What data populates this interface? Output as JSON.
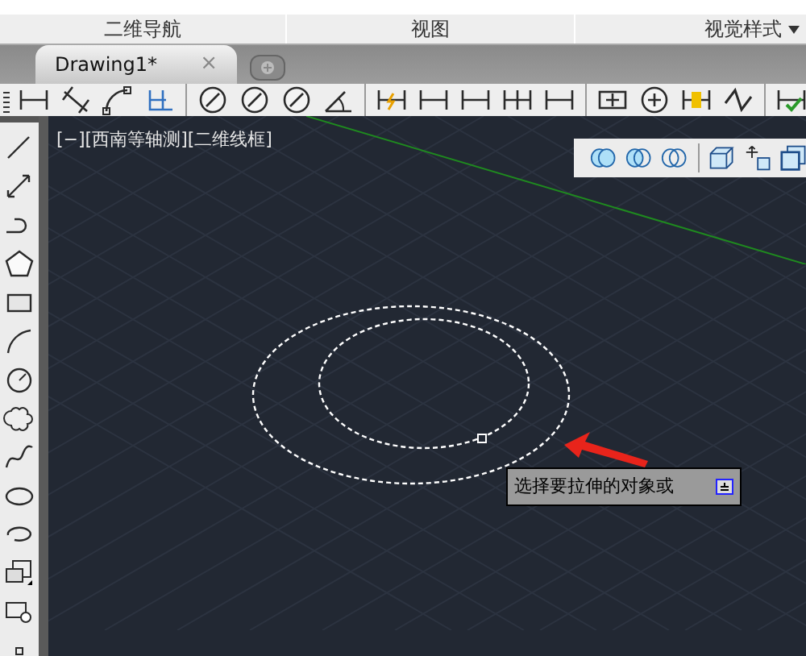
{
  "ribbon": {
    "panels": [
      {
        "label": "二维导航",
        "dropdown": false
      },
      {
        "label": "视图",
        "dropdown": false
      },
      {
        "label": "视觉样式",
        "dropdown": true
      }
    ]
  },
  "tabs": [
    {
      "label": "Drawing1*",
      "selected": true,
      "close": "×"
    }
  ],
  "viewport": {
    "label": "[−][西南等轴测][二维线框]"
  },
  "prompt": {
    "text": "选择要拉伸的对象或"
  }
}
